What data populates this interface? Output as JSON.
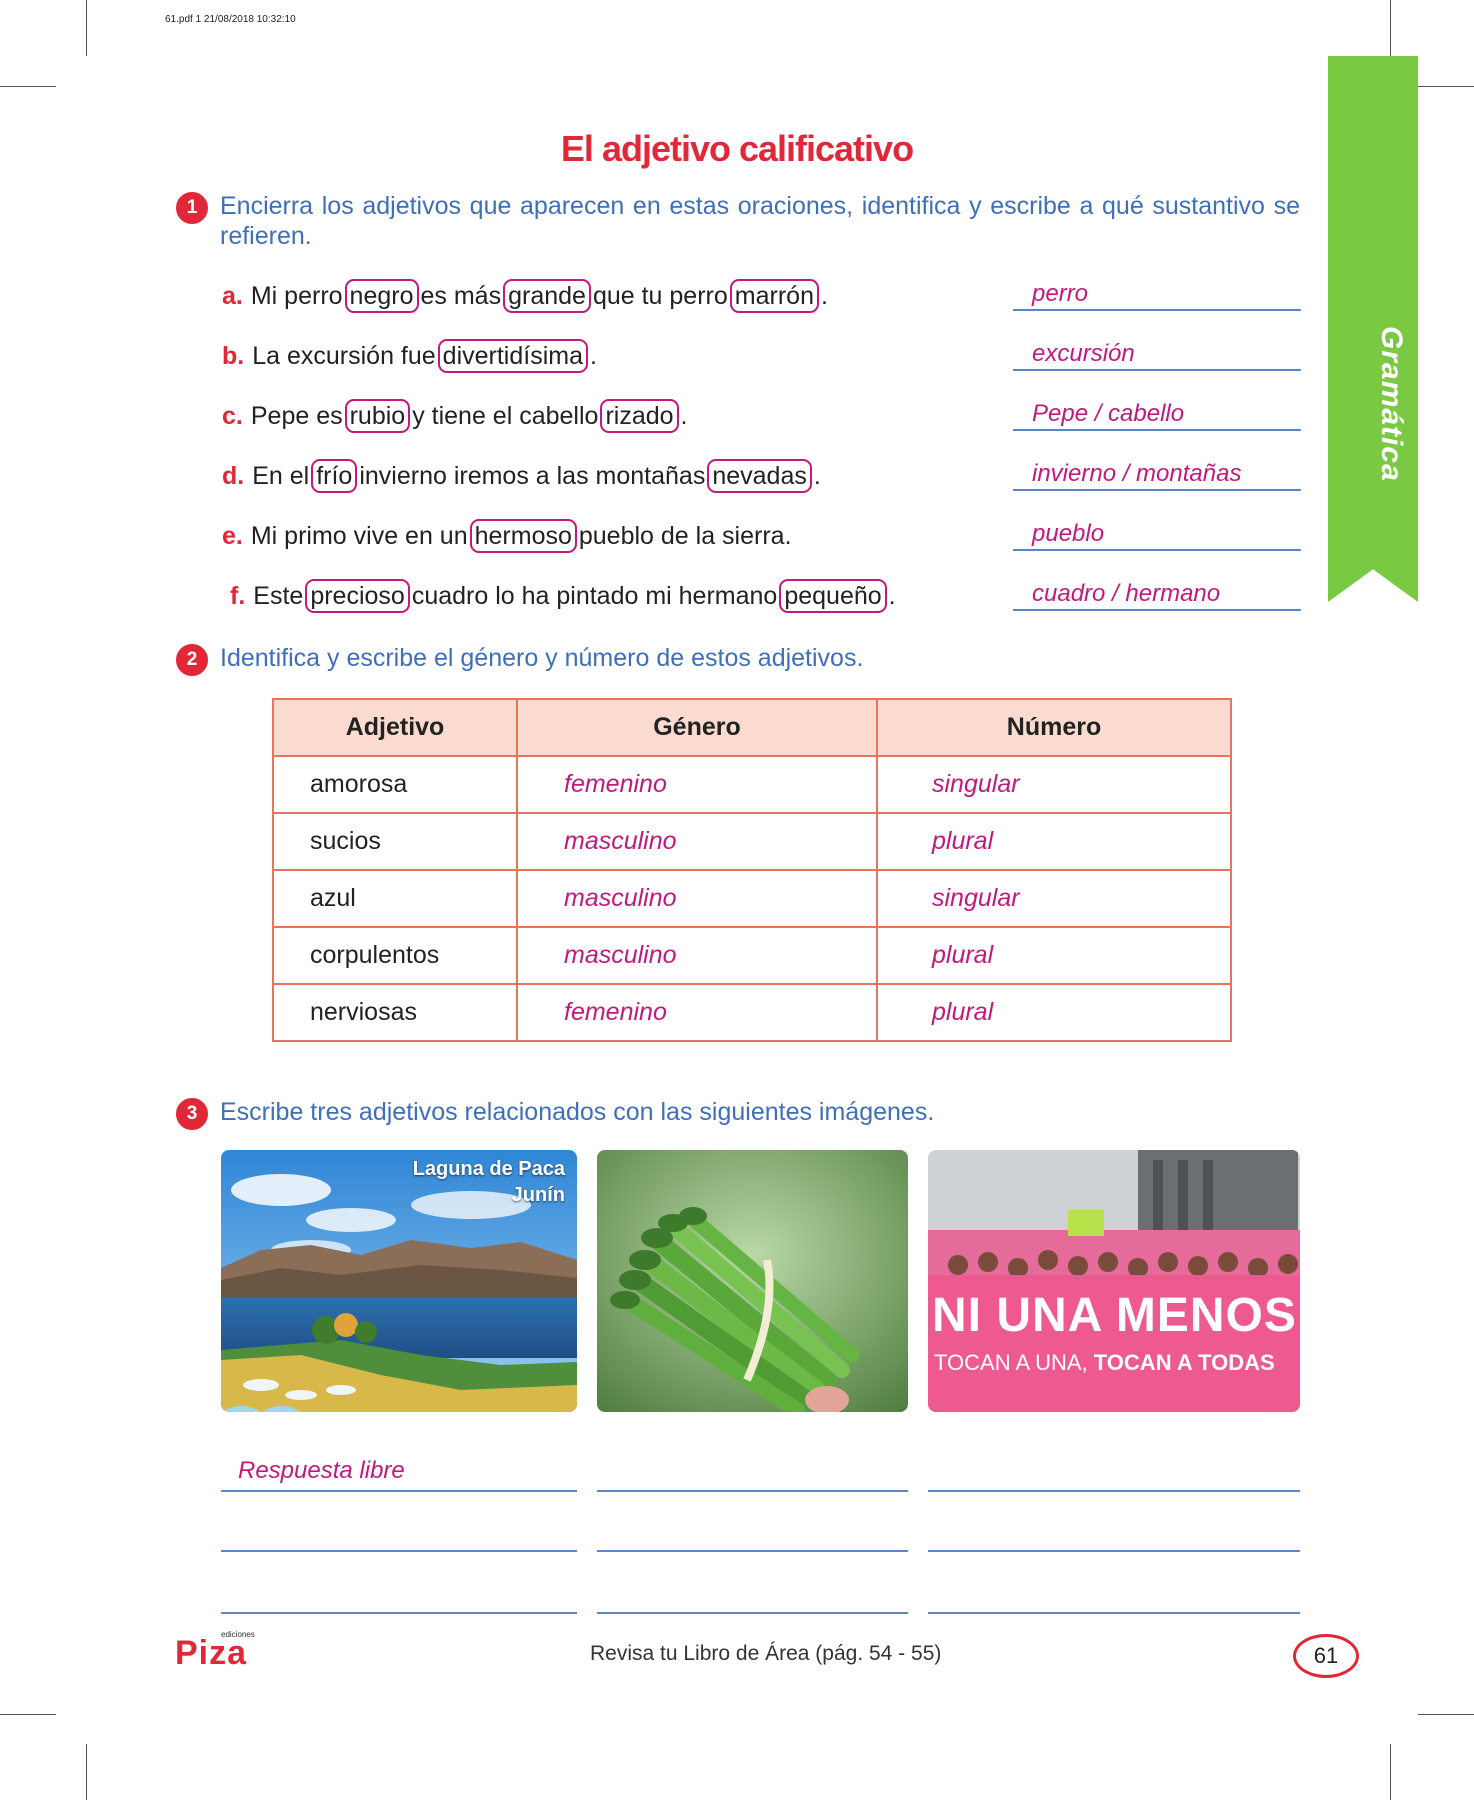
{
  "meta": {
    "file_stamp": "61.pdf  1  21/08/2018  10:32:10"
  },
  "side_tab": {
    "label": "Gramática"
  },
  "title": "El adjetivo calificativo",
  "exercise1": {
    "number": "1",
    "instruction": "Encierra los adjetivos que aparecen en estas oraciones, identifica y escribe a qué sustantivo se refieren.",
    "items": [
      {
        "label": "a.",
        "parts": [
          "Mi perro",
          "negro",
          "es más",
          "grande",
          "que tu perro",
          "marrón",
          "."
        ],
        "answer": "perro"
      },
      {
        "label": "b.",
        "parts": [
          "La excursión fue",
          "divertidísima",
          "."
        ],
        "answer": "excursión"
      },
      {
        "label": "c.",
        "parts": [
          "Pepe es",
          "rubio",
          "y tiene el cabello",
          "rizado",
          "."
        ],
        "answer": "Pepe / cabello"
      },
      {
        "label": "d.",
        "parts": [
          "En el",
          "frío",
          "invierno iremos a las montañas",
          "nevadas",
          "."
        ],
        "answer": "invierno / montañas"
      },
      {
        "label": "e.",
        "parts": [
          "Mi primo vive en un",
          "hermoso",
          "pueblo de la sierra."
        ],
        "answer": "pueblo"
      },
      {
        "label": "f.",
        "parts": [
          "Este",
          "precioso",
          "cuadro lo ha pintado mi hermano",
          "pequeño",
          "."
        ],
        "answer": "cuadro / hermano"
      }
    ]
  },
  "exercise2": {
    "number": "2",
    "instruction": "Identifica y escribe el género y número de estos adjetivos.",
    "headers": [
      "Adjetivo",
      "Género",
      "Número"
    ],
    "rows": [
      [
        "amorosa",
        "femenino",
        "singular"
      ],
      [
        "sucios",
        "masculino",
        "plural"
      ],
      [
        "azul",
        "masculino",
        "singular"
      ],
      [
        "corpulentos",
        "masculino",
        "plural"
      ],
      [
        "nerviosas",
        "femenino",
        "plural"
      ]
    ]
  },
  "exercise3": {
    "number": "3",
    "instruction": "Escribe tres adjetivos relacionados con las siguientes imágenes.",
    "photo1_caption_line1": "Laguna de Paca",
    "photo1_caption_line2": "Junín",
    "photo3_banner_line1": "NI UNA MENOS",
    "photo3_banner_line2a": "TOCAN A UNA,",
    "photo3_banner_line2b": "TOCAN A TODAS",
    "answer": "Respuesta libre"
  },
  "footer": {
    "logo_small": "ediciones",
    "logo": "Piza",
    "reference": "Revisa tu Libro de Área (pág. 54 - 55)",
    "page_number": "61"
  },
  "colors": {
    "accent_red": "#e02839",
    "magenta": "#c2197c",
    "blue": "#3f6fb8",
    "green_tab": "#7ac943",
    "table_header": "#fbdad0"
  }
}
